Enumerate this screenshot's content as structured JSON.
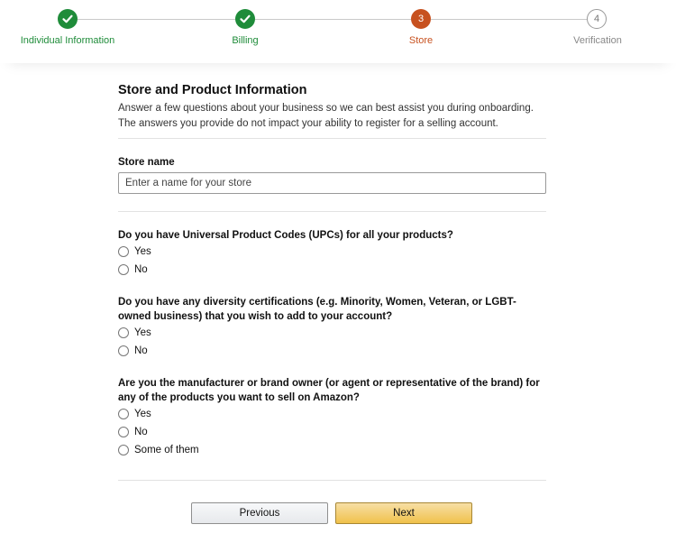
{
  "stepper": {
    "steps": [
      {
        "label": "Individual Information",
        "state": "done"
      },
      {
        "label": "Billing",
        "state": "done"
      },
      {
        "label": "Store",
        "number": "3",
        "state": "current"
      },
      {
        "label": "Verification",
        "number": "4",
        "state": "pending"
      }
    ],
    "colors": {
      "done": "#1f8c3a",
      "current": "#c7511f",
      "pending": "#888888"
    }
  },
  "section": {
    "title": "Store and Product Information",
    "description": "Answer a few questions about your business so we can best assist you during onboarding. The answers you provide do not impact your ability to register for a selling account."
  },
  "store_name": {
    "label": "Store name",
    "placeholder": "Enter a name for your store",
    "value": ""
  },
  "questions": [
    {
      "text": "Do you have Universal Product Codes (UPCs) for all your products?",
      "options": [
        "Yes",
        "No"
      ]
    },
    {
      "text": "Do you have any diversity certifications (e.g. Minority, Women, Veteran, or LGBT-owned business) that you wish to add to your account?",
      "options": [
        "Yes",
        "No"
      ]
    },
    {
      "text": "Are you the manufacturer or brand owner (or agent or representative of the brand) for any of the products you want to sell on Amazon?",
      "options": [
        "Yes",
        "No",
        "Some of them"
      ]
    }
  ],
  "buttons": {
    "previous": "Previous",
    "next": "Next"
  }
}
